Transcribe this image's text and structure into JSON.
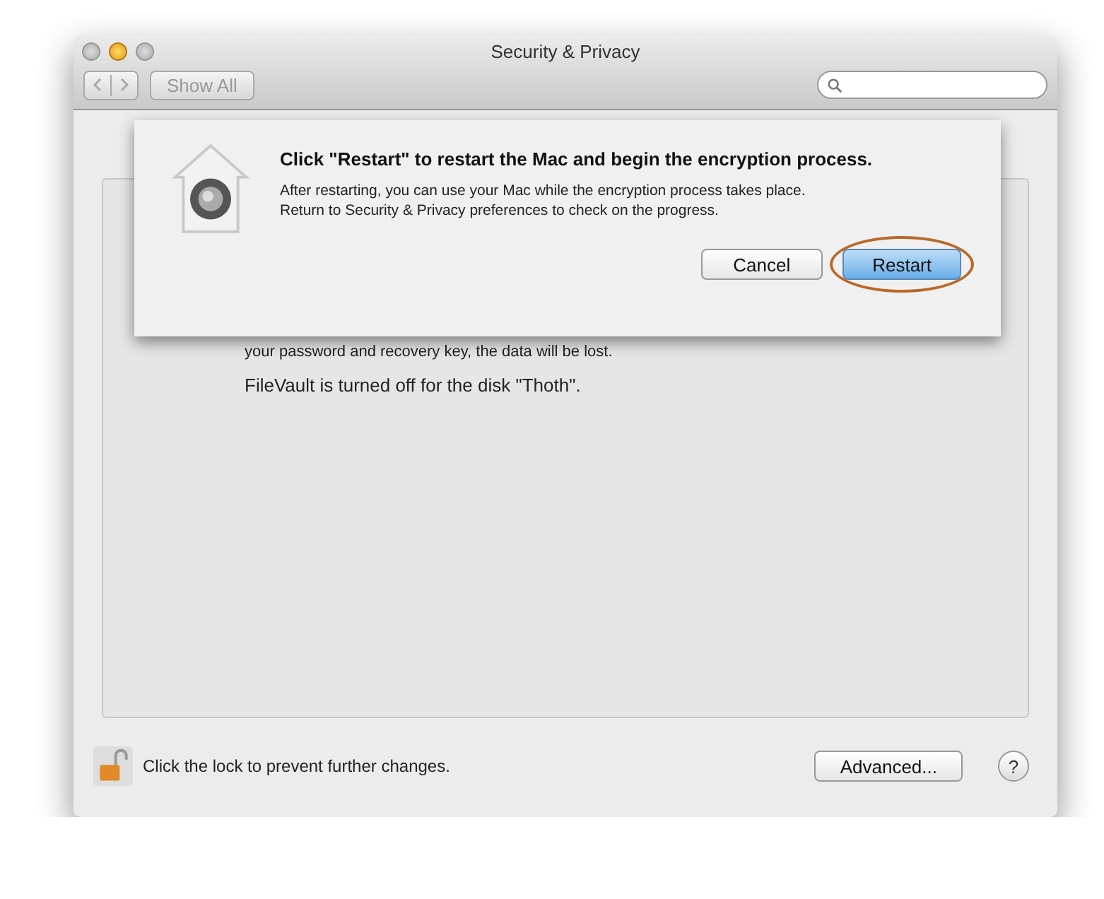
{
  "window": {
    "title": "Security & Privacy"
  },
  "toolbar": {
    "show_all": "Show All"
  },
  "pane": {
    "lines": [
      "your password and recovery key, the data will be lost.",
      "FileVault is turned off for the disk \"Thoth\"."
    ]
  },
  "sheet": {
    "title": "Click \"Restart\" to restart the Mac and begin the encryption process.",
    "message_lines": [
      "After restarting, you can use your Mac while the encryption process takes place.",
      "Return to Security & Privacy preferences to check on the progress."
    ],
    "buttons": [
      {
        "label": "Cancel",
        "default": false,
        "highlighted": false
      },
      {
        "label": "Restart",
        "default": true,
        "highlighted": true
      }
    ]
  },
  "footer": {
    "lock_text": "Click the lock to prevent further changes.",
    "advanced": "Advanced...",
    "help": "?"
  }
}
